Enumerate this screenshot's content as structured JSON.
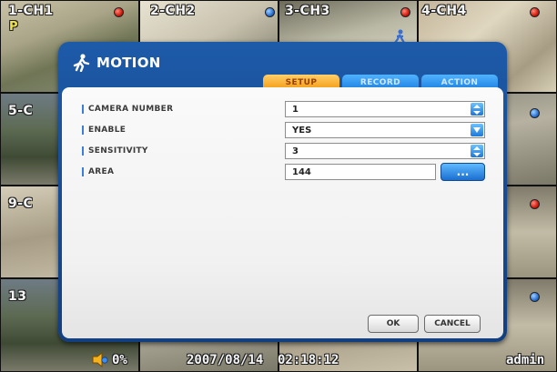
{
  "cameras": [
    {
      "label": "1-CH1",
      "status": "red"
    },
    {
      "label": "2-CH2",
      "status": "blue"
    },
    {
      "label": "3-CH3",
      "status": "red"
    },
    {
      "label": "4-CH4",
      "status": "red"
    },
    {
      "label": "5-C",
      "status": "blue"
    },
    {
      "label": "9-C",
      "status": "red"
    },
    {
      "label": "13",
      "status": "blue"
    }
  ],
  "p_marker": "P",
  "dialog": {
    "title": "MOTION",
    "icon": "running-person-icon",
    "tabs": [
      {
        "label": "SETUP",
        "active": true
      },
      {
        "label": "RECORD",
        "active": false
      },
      {
        "label": "ACTION",
        "active": false
      }
    ],
    "fields": {
      "camera_number": {
        "label": "CAMERA NUMBER",
        "value": "1"
      },
      "enable": {
        "label": "ENABLE",
        "value": "YES"
      },
      "sensitivity": {
        "label": "SENSITIVITY",
        "value": "3"
      },
      "area": {
        "label": "AREA",
        "value": "144",
        "button_label": "..."
      }
    },
    "buttons": {
      "ok": "OK",
      "cancel": "CANCEL"
    }
  },
  "status_bar": {
    "volume": "0%",
    "date": "2007/08/14",
    "time": "02:18:12",
    "user": "admin"
  },
  "colors": {
    "dialog_frame": "#1d5aa8",
    "tab_active": "#f39a10",
    "tab_inactive": "#1d7fe0",
    "record_dot": "#d21a0c",
    "motion_dot": "#2a72d6"
  }
}
